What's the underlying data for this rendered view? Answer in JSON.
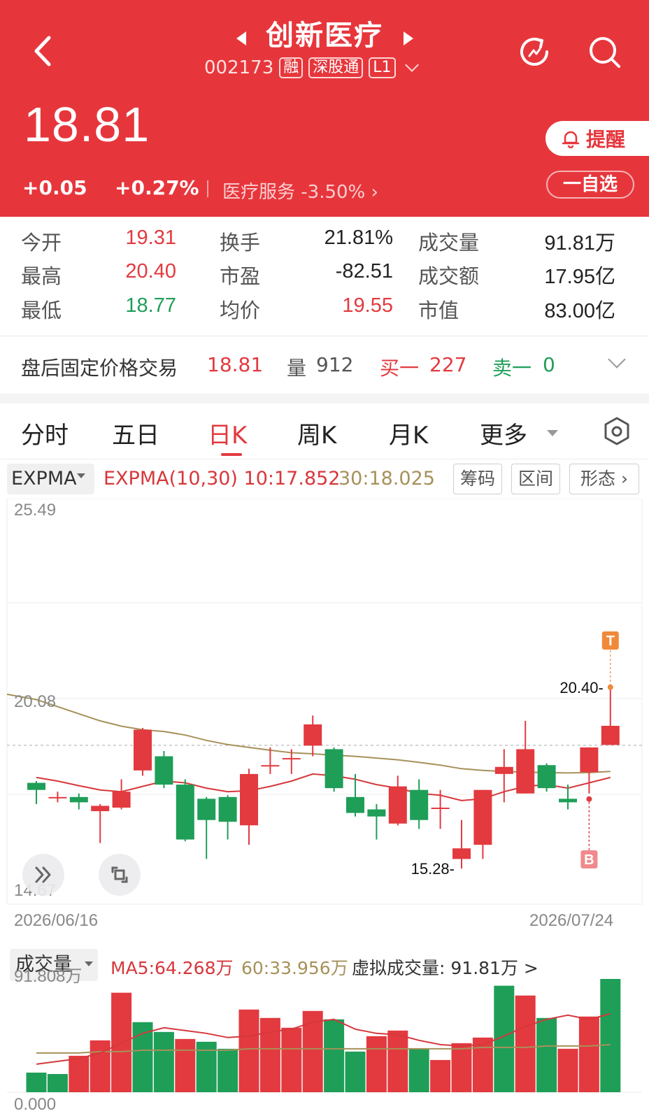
{
  "header": {
    "stock_name": "创新医疗",
    "code": "002173",
    "tags": [
      "融",
      "深股通",
      "L1"
    ],
    "price": "18.81",
    "change_abs": "+0.05",
    "change_pct": "+0.27%",
    "sector_name": "医疗服务",
    "sector_change": "-3.50%",
    "alert_label": "提醒",
    "watchlist_label": "一自选",
    "colors": {
      "header_bg": "#e6363c",
      "up": "#e23a3f",
      "down": "#1f9e58",
      "ma60": "#a7915a"
    }
  },
  "stats": [
    {
      "label": "今开",
      "value": "19.31",
      "color": "red"
    },
    {
      "label": "换手",
      "value": "21.81%",
      "color": "dark"
    },
    {
      "label": "成交量",
      "value": "91.81万",
      "color": "dark"
    },
    {
      "label": "最高",
      "value": "20.40",
      "color": "red"
    },
    {
      "label": "市盈",
      "value": "-82.51",
      "color": "dark"
    },
    {
      "label": "成交额",
      "value": "17.95亿",
      "color": "dark"
    },
    {
      "label": "最低",
      "value": "18.77",
      "color": "green"
    },
    {
      "label": "均价",
      "value": "19.55",
      "color": "red"
    },
    {
      "label": "市值",
      "value": "83.00亿",
      "color": "dark"
    }
  ],
  "after_hours": {
    "label": "盘后固定价格交易",
    "price": "18.81",
    "volume_label": "量",
    "volume": "912",
    "buy_label": "买一",
    "buy_value": "227",
    "sell_label": "卖一",
    "sell_value": "0"
  },
  "tabs": [
    {
      "label": "分时",
      "active": false
    },
    {
      "label": "五日",
      "active": false
    },
    {
      "label": "日K",
      "active": true
    },
    {
      "label": "周K",
      "active": false
    },
    {
      "label": "月K",
      "active": false
    },
    {
      "label": "更多",
      "active": false
    }
  ],
  "indicator": {
    "selector": "EXPMA",
    "label": "EXPMA(10,30) 10:17.852",
    "value30": "30:18.025",
    "buttons": [
      "筹码",
      "区间",
      "形态"
    ]
  },
  "chart_data": [
    {
      "type": "candlestick",
      "ylim": [
        14.67,
        25.49
      ],
      "y_ticks": [
        "25.49",
        "20.08",
        "14.67"
      ],
      "x_start": "2026/06/16",
      "x_end": "2026/07/24",
      "high_label": "20.40",
      "low_label": "15.28",
      "marker_top": "T",
      "marker_bottom": "B",
      "prev_close": 18.76,
      "candles": [
        {
          "o": 17.7,
          "c": 17.5,
          "h": 17.75,
          "l": 17.1
        },
        {
          "o": 17.3,
          "c": 17.3,
          "h": 17.45,
          "l": 17.15
        },
        {
          "o": 17.3,
          "c": 17.15,
          "h": 17.4,
          "l": 16.95
        },
        {
          "o": 16.9,
          "c": 17.05,
          "h": 17.1,
          "l": 16.0
        },
        {
          "o": 17.0,
          "c": 17.45,
          "h": 17.8,
          "l": 16.95
        },
        {
          "o": 18.05,
          "c": 19.2,
          "h": 19.25,
          "l": 17.9
        },
        {
          "o": 18.45,
          "c": 17.65,
          "h": 18.6,
          "l": 17.55
        },
        {
          "o": 17.65,
          "c": 16.1,
          "h": 17.8,
          "l": 16.05
        },
        {
          "o": 17.25,
          "c": 16.65,
          "h": 17.3,
          "l": 15.55
        },
        {
          "o": 17.3,
          "c": 16.6,
          "h": 17.35,
          "l": 16.1
        },
        {
          "o": 16.5,
          "c": 17.95,
          "h": 18.1,
          "l": 15.95
        },
        {
          "o": 18.2,
          "c": 18.2,
          "h": 18.7,
          "l": 17.95
        },
        {
          "o": 18.4,
          "c": 18.4,
          "h": 18.65,
          "l": 17.95
        },
        {
          "o": 18.75,
          "c": 19.35,
          "h": 19.6,
          "l": 18.45
        },
        {
          "o": 18.65,
          "c": 17.55,
          "h": 18.7,
          "l": 17.45
        },
        {
          "o": 17.3,
          "c": 16.85,
          "h": 17.95,
          "l": 16.75
        },
        {
          "o": 16.95,
          "c": 16.75,
          "h": 17.1,
          "l": 16.1
        },
        {
          "o": 16.55,
          "c": 17.6,
          "h": 17.9,
          "l": 16.5
        },
        {
          "o": 17.5,
          "c": 16.65,
          "h": 17.8,
          "l": 16.4
        },
        {
          "o": 17.0,
          "c": 17.0,
          "h": 17.5,
          "l": 16.4
        },
        {
          "o": 15.55,
          "c": 15.85,
          "h": 16.65,
          "l": 15.28
        },
        {
          "o": 15.95,
          "c": 17.5,
          "h": 17.5,
          "l": 15.55
        },
        {
          "o": 17.95,
          "c": 18.15,
          "h": 18.65,
          "l": 17.15
        },
        {
          "o": 17.4,
          "c": 18.65,
          "h": 19.45,
          "l": 17.4
        },
        {
          "o": 18.2,
          "c": 17.55,
          "h": 18.25,
          "l": 17.45
        },
        {
          "o": 17.25,
          "c": 17.15,
          "h": 17.65,
          "l": 16.95
        },
        {
          "o": 18.0,
          "c": 18.7,
          "h": 18.7,
          "l": 17.4
        },
        {
          "o": 18.77,
          "c": 19.31,
          "h": 20.4,
          "l": 18.77
        }
      ],
      "ema10": [
        17.85,
        17.75,
        17.62,
        17.5,
        17.45,
        17.6,
        17.75,
        17.7,
        17.55,
        17.45,
        17.48,
        17.6,
        17.75,
        17.95,
        17.9,
        17.8,
        17.65,
        17.55,
        17.4,
        17.35,
        17.2,
        17.25,
        17.45,
        17.6,
        17.65,
        17.55,
        17.7,
        17.85
      ],
      "ema30": [
        20.05,
        19.85,
        19.65,
        19.45,
        19.3,
        19.2,
        19.15,
        19.05,
        18.9,
        18.78,
        18.7,
        18.62,
        18.55,
        18.52,
        18.48,
        18.45,
        18.4,
        18.35,
        18.28,
        18.2,
        18.1,
        18.05,
        18.02,
        18.0,
        17.99,
        17.98,
        17.99,
        18.02
      ]
    },
    {
      "type": "bar",
      "name": "成交量",
      "ylim": [
        0,
        91.808
      ],
      "y_ticks": [
        "91.808万",
        "0.000"
      ],
      "values": [
        14,
        13,
        26,
        37,
        71,
        50,
        43,
        38,
        36,
        31,
        59,
        53,
        46,
        58,
        52,
        29,
        40,
        44,
        31,
        23,
        35,
        39,
        76,
        69,
        53,
        31,
        54,
        91.808
      ],
      "up": [
        false,
        false,
        true,
        true,
        true,
        false,
        false,
        true,
        false,
        false,
        true,
        true,
        true,
        true,
        false,
        false,
        true,
        true,
        false,
        true,
        true,
        true,
        false,
        true,
        false,
        true,
        true,
        false
      ],
      "ma5": [
        20,
        22,
        24,
        28,
        35,
        42,
        46,
        44,
        42,
        39,
        40,
        43,
        45,
        50,
        52,
        45,
        42,
        41,
        37,
        34,
        33,
        34,
        40,
        47,
        52,
        55,
        52,
        56
      ],
      "ma60": [
        28,
        28,
        28,
        29,
        29,
        30,
        30,
        30,
        30,
        30,
        31,
        31,
        31,
        31,
        31,
        31,
        31,
        31,
        31,
        31,
        31,
        32,
        32,
        32,
        33,
        33,
        33,
        34
      ]
    }
  ],
  "volume": {
    "selector": "成交量",
    "ma5_label": "MA5:64.268万",
    "ma60_label": "60:33.956万",
    "virtual_label": "虚拟成交量:",
    "virtual_value": "91.81万 >"
  }
}
